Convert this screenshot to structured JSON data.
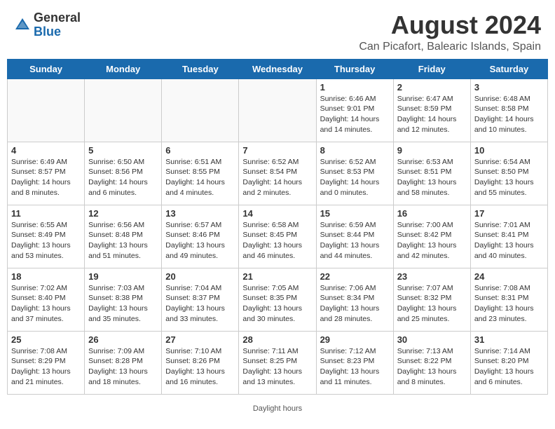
{
  "logo": {
    "general": "General",
    "blue": "Blue"
  },
  "title": "August 2024",
  "location": "Can Picafort, Balearic Islands, Spain",
  "headers": [
    "Sunday",
    "Monday",
    "Tuesday",
    "Wednesday",
    "Thursday",
    "Friday",
    "Saturday"
  ],
  "weeks": [
    [
      {
        "day": "",
        "info": ""
      },
      {
        "day": "",
        "info": ""
      },
      {
        "day": "",
        "info": ""
      },
      {
        "day": "",
        "info": ""
      },
      {
        "day": "1",
        "info": "Sunrise: 6:46 AM\nSunset: 9:01 PM\nDaylight: 14 hours\nand 14 minutes."
      },
      {
        "day": "2",
        "info": "Sunrise: 6:47 AM\nSunset: 8:59 PM\nDaylight: 14 hours\nand 12 minutes."
      },
      {
        "day": "3",
        "info": "Sunrise: 6:48 AM\nSunset: 8:58 PM\nDaylight: 14 hours\nand 10 minutes."
      }
    ],
    [
      {
        "day": "4",
        "info": "Sunrise: 6:49 AM\nSunset: 8:57 PM\nDaylight: 14 hours\nand 8 minutes."
      },
      {
        "day": "5",
        "info": "Sunrise: 6:50 AM\nSunset: 8:56 PM\nDaylight: 14 hours\nand 6 minutes."
      },
      {
        "day": "6",
        "info": "Sunrise: 6:51 AM\nSunset: 8:55 PM\nDaylight: 14 hours\nand 4 minutes."
      },
      {
        "day": "7",
        "info": "Sunrise: 6:52 AM\nSunset: 8:54 PM\nDaylight: 14 hours\nand 2 minutes."
      },
      {
        "day": "8",
        "info": "Sunrise: 6:52 AM\nSunset: 8:53 PM\nDaylight: 14 hours\nand 0 minutes."
      },
      {
        "day": "9",
        "info": "Sunrise: 6:53 AM\nSunset: 8:51 PM\nDaylight: 13 hours\nand 58 minutes."
      },
      {
        "day": "10",
        "info": "Sunrise: 6:54 AM\nSunset: 8:50 PM\nDaylight: 13 hours\nand 55 minutes."
      }
    ],
    [
      {
        "day": "11",
        "info": "Sunrise: 6:55 AM\nSunset: 8:49 PM\nDaylight: 13 hours\nand 53 minutes."
      },
      {
        "day": "12",
        "info": "Sunrise: 6:56 AM\nSunset: 8:48 PM\nDaylight: 13 hours\nand 51 minutes."
      },
      {
        "day": "13",
        "info": "Sunrise: 6:57 AM\nSunset: 8:46 PM\nDaylight: 13 hours\nand 49 minutes."
      },
      {
        "day": "14",
        "info": "Sunrise: 6:58 AM\nSunset: 8:45 PM\nDaylight: 13 hours\nand 46 minutes."
      },
      {
        "day": "15",
        "info": "Sunrise: 6:59 AM\nSunset: 8:44 PM\nDaylight: 13 hours\nand 44 minutes."
      },
      {
        "day": "16",
        "info": "Sunrise: 7:00 AM\nSunset: 8:42 PM\nDaylight: 13 hours\nand 42 minutes."
      },
      {
        "day": "17",
        "info": "Sunrise: 7:01 AM\nSunset: 8:41 PM\nDaylight: 13 hours\nand 40 minutes."
      }
    ],
    [
      {
        "day": "18",
        "info": "Sunrise: 7:02 AM\nSunset: 8:40 PM\nDaylight: 13 hours\nand 37 minutes."
      },
      {
        "day": "19",
        "info": "Sunrise: 7:03 AM\nSunset: 8:38 PM\nDaylight: 13 hours\nand 35 minutes."
      },
      {
        "day": "20",
        "info": "Sunrise: 7:04 AM\nSunset: 8:37 PM\nDaylight: 13 hours\nand 33 minutes."
      },
      {
        "day": "21",
        "info": "Sunrise: 7:05 AM\nSunset: 8:35 PM\nDaylight: 13 hours\nand 30 minutes."
      },
      {
        "day": "22",
        "info": "Sunrise: 7:06 AM\nSunset: 8:34 PM\nDaylight: 13 hours\nand 28 minutes."
      },
      {
        "day": "23",
        "info": "Sunrise: 7:07 AM\nSunset: 8:32 PM\nDaylight: 13 hours\nand 25 minutes."
      },
      {
        "day": "24",
        "info": "Sunrise: 7:08 AM\nSunset: 8:31 PM\nDaylight: 13 hours\nand 23 minutes."
      }
    ],
    [
      {
        "day": "25",
        "info": "Sunrise: 7:08 AM\nSunset: 8:29 PM\nDaylight: 13 hours\nand 21 minutes."
      },
      {
        "day": "26",
        "info": "Sunrise: 7:09 AM\nSunset: 8:28 PM\nDaylight: 13 hours\nand 18 minutes."
      },
      {
        "day": "27",
        "info": "Sunrise: 7:10 AM\nSunset: 8:26 PM\nDaylight: 13 hours\nand 16 minutes."
      },
      {
        "day": "28",
        "info": "Sunrise: 7:11 AM\nSunset: 8:25 PM\nDaylight: 13 hours\nand 13 minutes."
      },
      {
        "day": "29",
        "info": "Sunrise: 7:12 AM\nSunset: 8:23 PM\nDaylight: 13 hours\nand 11 minutes."
      },
      {
        "day": "30",
        "info": "Sunrise: 7:13 AM\nSunset: 8:22 PM\nDaylight: 13 hours\nand 8 minutes."
      },
      {
        "day": "31",
        "info": "Sunrise: 7:14 AM\nSunset: 8:20 PM\nDaylight: 13 hours\nand 6 minutes."
      }
    ]
  ],
  "footer": "Daylight hours"
}
